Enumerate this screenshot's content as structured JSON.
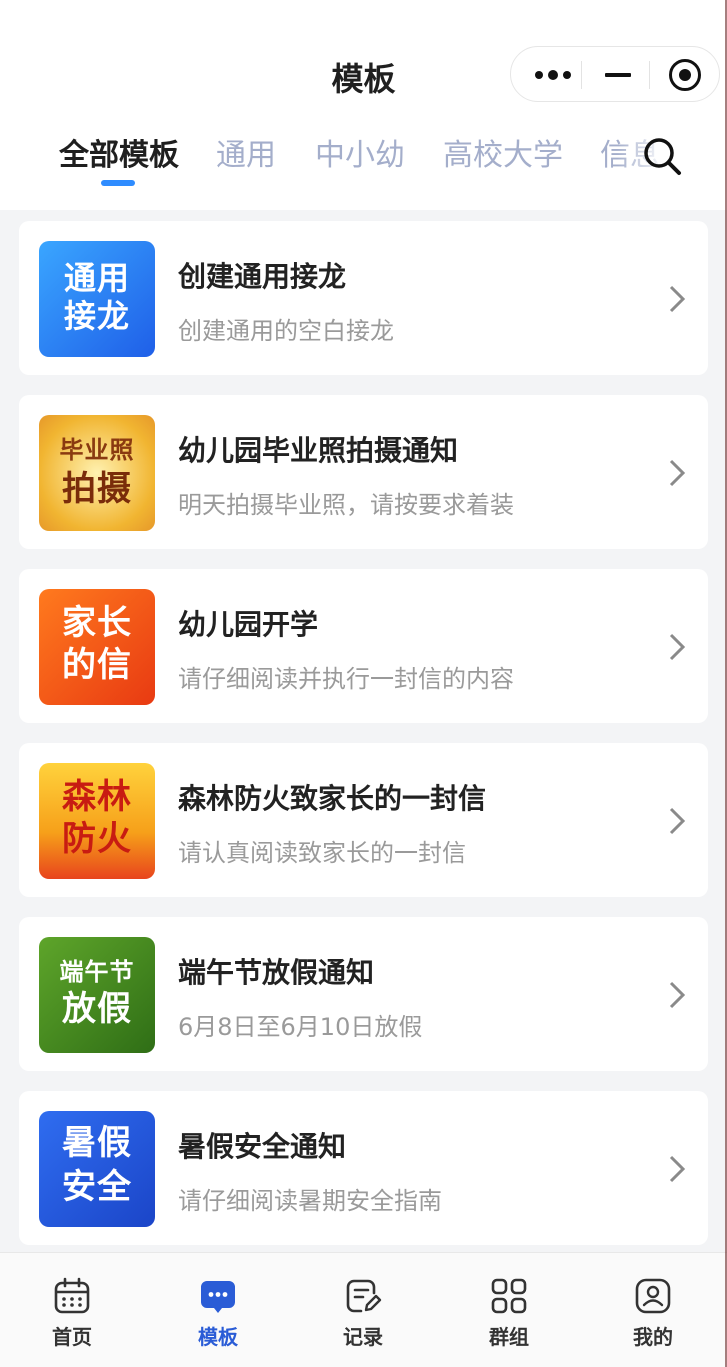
{
  "header": {
    "title": "模板",
    "capsule": {
      "more": "more-icon",
      "minimize": "minimize-icon",
      "close": "target-icon"
    }
  },
  "tabs": [
    {
      "label": "全部模板",
      "active": true
    },
    {
      "label": "通用",
      "active": false
    },
    {
      "label": "中小幼",
      "active": false
    },
    {
      "label": "高校大学",
      "active": false
    },
    {
      "label": "信息",
      "active": false
    }
  ],
  "templates": [
    {
      "title": "创建通用接龙",
      "subtitle": "创建通用的空白接龙",
      "thumb_lines": [
        "通用",
        "接龙"
      ],
      "thumb_bg": "#2a78f0"
    },
    {
      "title": "幼儿园毕业照拍摄通知",
      "subtitle": "明天拍摄毕业照，请按要求着装",
      "thumb_lines": [
        "毕业照",
        "拍摄"
      ],
      "thumb_bg": "#f6c244"
    },
    {
      "title": "幼儿园开学",
      "subtitle": "请仔细阅读并执行一封信的内容",
      "thumb_lines": [
        "家长",
        "的信"
      ],
      "thumb_bg": "#f2541b"
    },
    {
      "title": "森林防火致家长的一封信",
      "subtitle": "请认真阅读致家长的一封信",
      "thumb_lines": [
        "森林",
        "防火"
      ],
      "thumb_bg": "#f6a91a"
    },
    {
      "title": "端午节放假通知",
      "subtitle": "6月8日至6月10日放假",
      "thumb_lines": [
        "端午节",
        "放假"
      ],
      "thumb_bg": "#3e8a1e"
    },
    {
      "title": "暑假安全通知",
      "subtitle": "请仔细阅读暑期安全指南",
      "thumb_lines": [
        "暑假",
        "安全"
      ],
      "thumb_bg": "#2456e0"
    }
  ],
  "tabbar": [
    {
      "label": "首页",
      "icon": "calendar-icon",
      "active": false
    },
    {
      "label": "模板",
      "icon": "chat-bubble-icon",
      "active": true
    },
    {
      "label": "记录",
      "icon": "edit-note-icon",
      "active": false
    },
    {
      "label": "群组",
      "icon": "grid-icon",
      "active": false
    },
    {
      "label": "我的",
      "icon": "user-icon",
      "active": false
    }
  ],
  "colors": {
    "accent": "#2f8cff",
    "tab_active": "#2a5cd6",
    "tab_inactive": "#a4aecb"
  }
}
